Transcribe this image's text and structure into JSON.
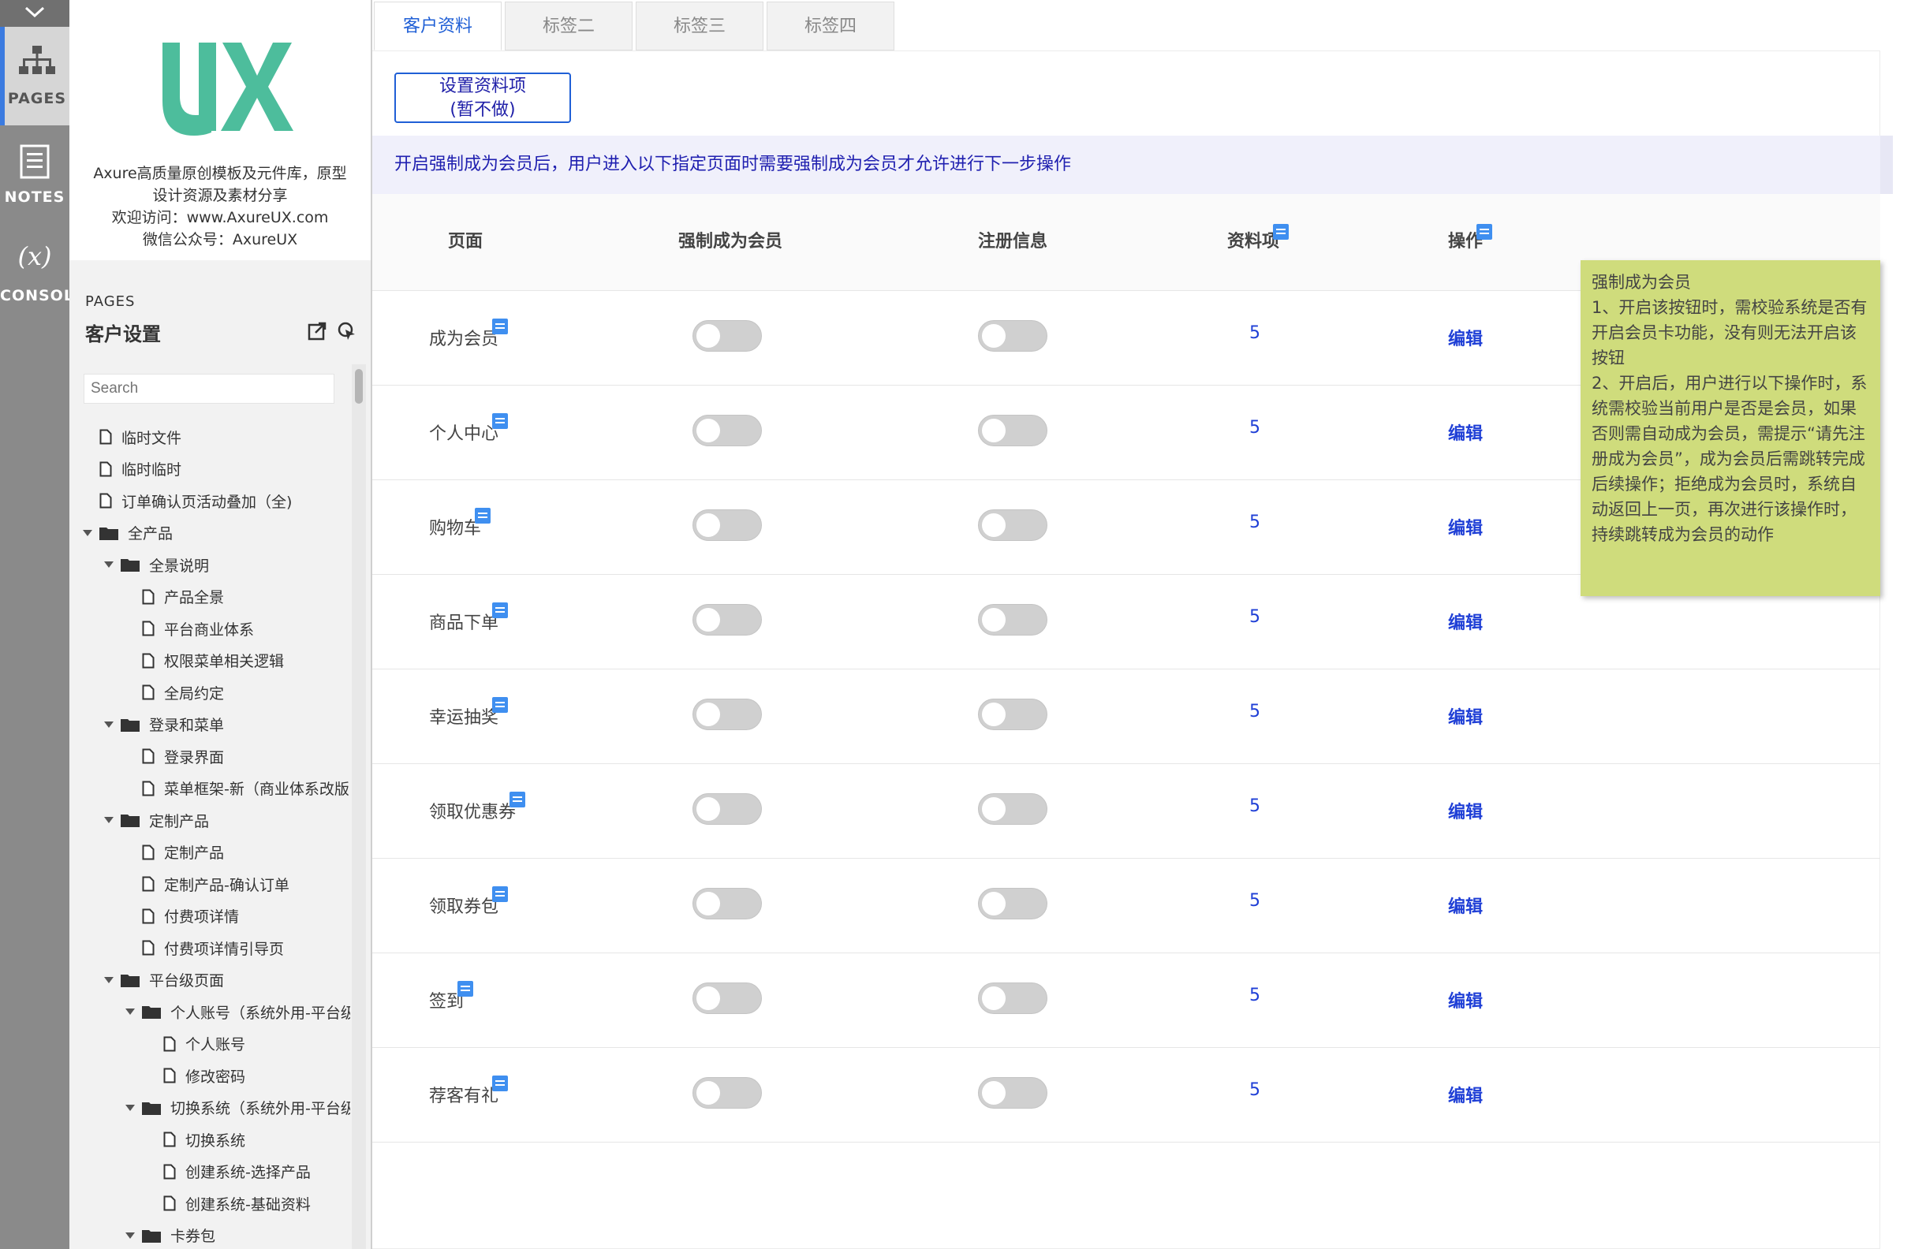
{
  "rail": {
    "items": [
      {
        "label": "PAGES",
        "icon": "sitemap-icon",
        "active": true
      },
      {
        "label": "NOTES",
        "icon": "notes-icon",
        "active": false
      },
      {
        "label": "CONSOL",
        "icon": "variable-icon",
        "active": false
      }
    ],
    "variable_glyph": "(x)"
  },
  "brand": {
    "logo_text": "UX",
    "description_lines": [
      "Axure高质量原创模板及元件库，原型",
      "设计资源及素材分享",
      "欢迎访问：www.AxureUX.com",
      "微信公众号：AxureUX"
    ],
    "logo_color": "#4dbd9c"
  },
  "pages_panel": {
    "header": "PAGES",
    "title": "客户设置",
    "search_placeholder": "Search"
  },
  "tree": [
    {
      "label": "临时文件",
      "type": "page",
      "level": 0
    },
    {
      "label": "临时临时",
      "type": "page",
      "level": 0
    },
    {
      "label": "订单确认页活动叠加（全)",
      "type": "page",
      "level": 0
    },
    {
      "label": "全产品",
      "type": "folder",
      "level": 0
    },
    {
      "label": "全景说明",
      "type": "folder",
      "level": 1
    },
    {
      "label": "产品全景",
      "type": "page",
      "level": 2
    },
    {
      "label": "平台商业体系",
      "type": "page",
      "level": 2
    },
    {
      "label": "权限菜单相关逻辑",
      "type": "page",
      "level": 2
    },
    {
      "label": "全局约定",
      "type": "page",
      "level": 2
    },
    {
      "label": "登录和菜单",
      "type": "folder",
      "level": 1
    },
    {
      "label": "登录界面",
      "type": "page",
      "level": 2
    },
    {
      "label": "菜单框架-新（商业体系改版",
      "type": "page",
      "level": 2
    },
    {
      "label": "定制产品",
      "type": "folder",
      "level": 1
    },
    {
      "label": "定制产品",
      "type": "page",
      "level": 2
    },
    {
      "label": "定制产品-确认订单",
      "type": "page",
      "level": 2
    },
    {
      "label": "付费项详情",
      "type": "page",
      "level": 2
    },
    {
      "label": "付费项详情引导页",
      "type": "page",
      "level": 2
    },
    {
      "label": "平台级页面",
      "type": "folder",
      "level": 1
    },
    {
      "label": "个人账号（系统外用-平台级",
      "type": "folder",
      "level": 2
    },
    {
      "label": "个人账号",
      "type": "page",
      "level": 3
    },
    {
      "label": "修改密码",
      "type": "page",
      "level": 3
    },
    {
      "label": "切换系统（系统外用-平台级",
      "type": "folder",
      "level": 2
    },
    {
      "label": "切换系统",
      "type": "page",
      "level": 3
    },
    {
      "label": "创建系统-选择产品",
      "type": "page",
      "level": 3
    },
    {
      "label": "创建系统-基础资料",
      "type": "page",
      "level": 3
    },
    {
      "label": "卡券包",
      "type": "folder",
      "level": 2
    }
  ],
  "tabs": [
    {
      "label": "客户资料",
      "active": true
    },
    {
      "label": "标签二",
      "active": false
    },
    {
      "label": "标签三",
      "active": false
    },
    {
      "label": "标签四",
      "active": false
    }
  ],
  "setup_button": {
    "line1": "设置资料项",
    "line2": "(暂不做)"
  },
  "notice": "开启强制成为会员后，用户进入以下指定页面时需要强制成为会员才允许进行下一步操作",
  "table": {
    "headers": {
      "page": "页面",
      "force": "强制成为会员",
      "register": "注册信息",
      "items": "资料项",
      "action": "操作"
    },
    "rows": [
      {
        "page": "成为会员",
        "force_on": false,
        "register_on": false,
        "count": "5",
        "action": "编辑"
      },
      {
        "page": "个人中心",
        "force_on": false,
        "register_on": false,
        "count": "5",
        "action": "编辑"
      },
      {
        "page": "购物车",
        "force_on": false,
        "register_on": false,
        "count": "5",
        "action": "编辑"
      },
      {
        "page": "商品下单",
        "force_on": false,
        "register_on": false,
        "count": "5",
        "action": "编辑"
      },
      {
        "page": "幸运抽奖",
        "force_on": false,
        "register_on": false,
        "count": "5",
        "action": "编辑"
      },
      {
        "page": "领取优惠券",
        "force_on": false,
        "register_on": false,
        "count": "5",
        "action": "编辑"
      },
      {
        "page": "领取券包",
        "force_on": false,
        "register_on": false,
        "count": "5",
        "action": "编辑"
      },
      {
        "page": "签到",
        "force_on": false,
        "register_on": false,
        "count": "5",
        "action": "编辑"
      },
      {
        "page": "荐客有礼",
        "force_on": false,
        "register_on": false,
        "count": "5",
        "action": "编辑"
      }
    ]
  },
  "tooltip": {
    "lines": [
      "强制成为会员",
      "1、开启该按钮时，需校验系统是否有开启会员卡功能，没有则无法开启该按钮",
      "2、开启后，用户进行以下操作时，系统需校验当前用户是否是会员，如果否则需自动成为会员，需提示“请先注册成为会员”，成为会员后需跳转完成后续操作；拒绝成为会员时，系统自动返回上一页，再次进行该操作时，持续跳转成为会员的动作"
    ]
  },
  "colors": {
    "accent": "#1f5fd6",
    "link": "#1f3fd6",
    "note_marker": "#3f8ff0",
    "tooltip_bg": "#cfdc7c",
    "rail_bg": "#8a8a8a"
  }
}
